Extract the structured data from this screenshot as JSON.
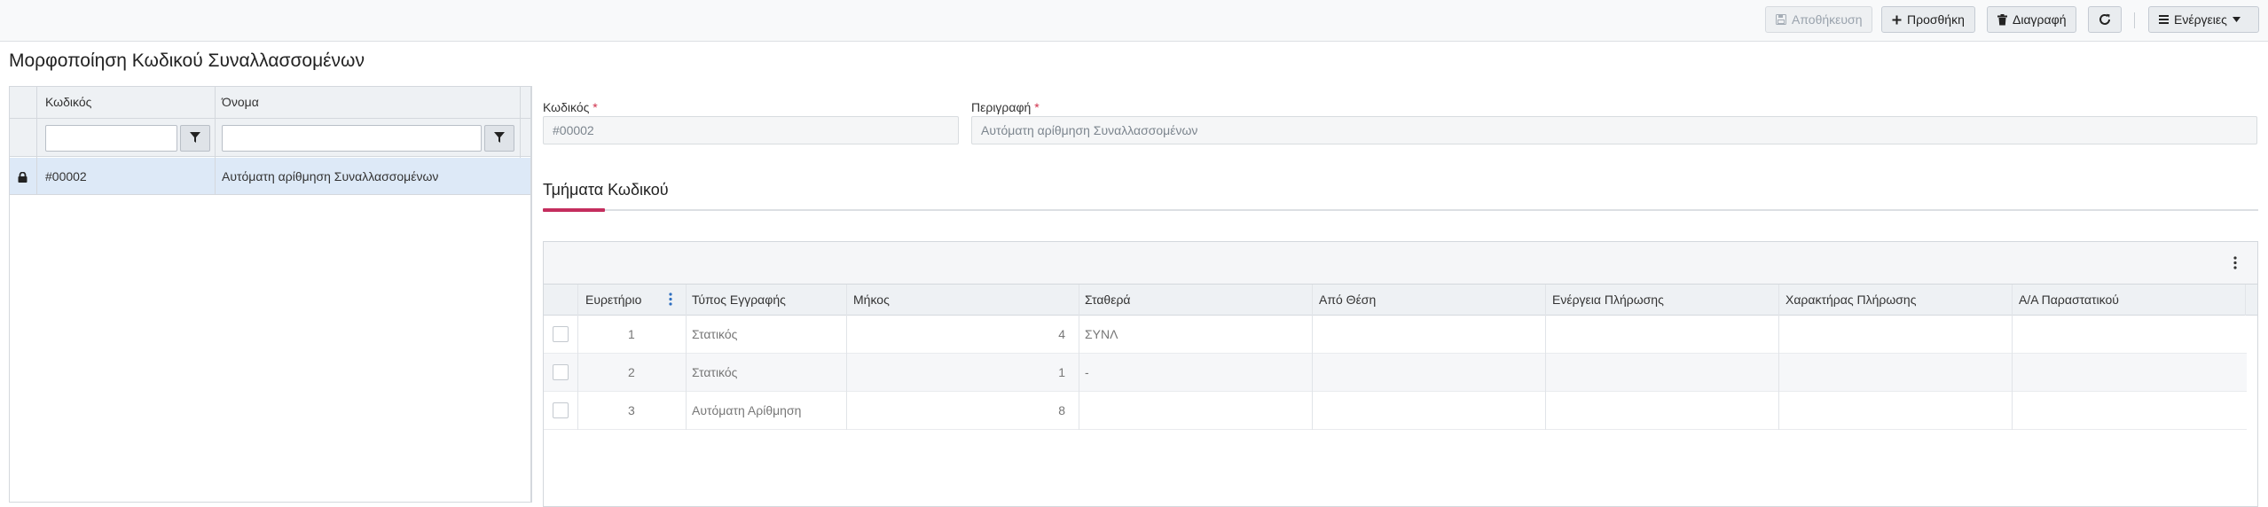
{
  "toolbar": {
    "save_label": "Αποθήκευση",
    "add_label": "Προσθήκη",
    "delete_label": "Διαγραφή",
    "actions_label": "Ενέργειες"
  },
  "page": {
    "title": "Μορφοποίηση Κωδικού Συναλλασσομένων"
  },
  "left_grid": {
    "columns": [
      "Κωδικός",
      "Όνομα"
    ],
    "rows": [
      {
        "code": "#00002",
        "name": "Αυτόματη αρίθμηση Συναλλασσομένων",
        "locked": true
      }
    ]
  },
  "form": {
    "code_label": "Κωδικός",
    "code_value": "#00002",
    "description_label": "Περιγραφή",
    "description_value": "Αυτόματη αρίθμηση Συναλλασσομένων",
    "required_mark": "*"
  },
  "section": {
    "title": "Τμήματα Κωδικού"
  },
  "parts_grid": {
    "columns": [
      "Ευρετήριο",
      "Τύπος Εγγραφής",
      "Μήκος",
      "Σταθερά",
      "Από Θέση",
      "Ενέργεια Πλήρωσης",
      "Χαρακτήρας Πλήρωσης",
      "Α/Α Παραστατικού"
    ],
    "rows": [
      {
        "index": "1",
        "type": "Στατικός",
        "length": "4",
        "constant": "ΣΥΝΛ",
        "from": "",
        "fill_action": "",
        "fill_char": "",
        "doc_seq": ""
      },
      {
        "index": "2",
        "type": "Στατικός",
        "length": "1",
        "constant": "-",
        "from": "",
        "fill_action": "",
        "fill_char": "",
        "doc_seq": ""
      },
      {
        "index": "3",
        "type": "Αυτόματη Αρίθμηση",
        "length": "8",
        "constant": "",
        "from": "",
        "fill_action": "",
        "fill_char": "",
        "doc_seq": ""
      }
    ]
  },
  "colors": {
    "accent": "#c42d5e",
    "selected_row": "#dde9f7",
    "required": "#d0314b"
  }
}
